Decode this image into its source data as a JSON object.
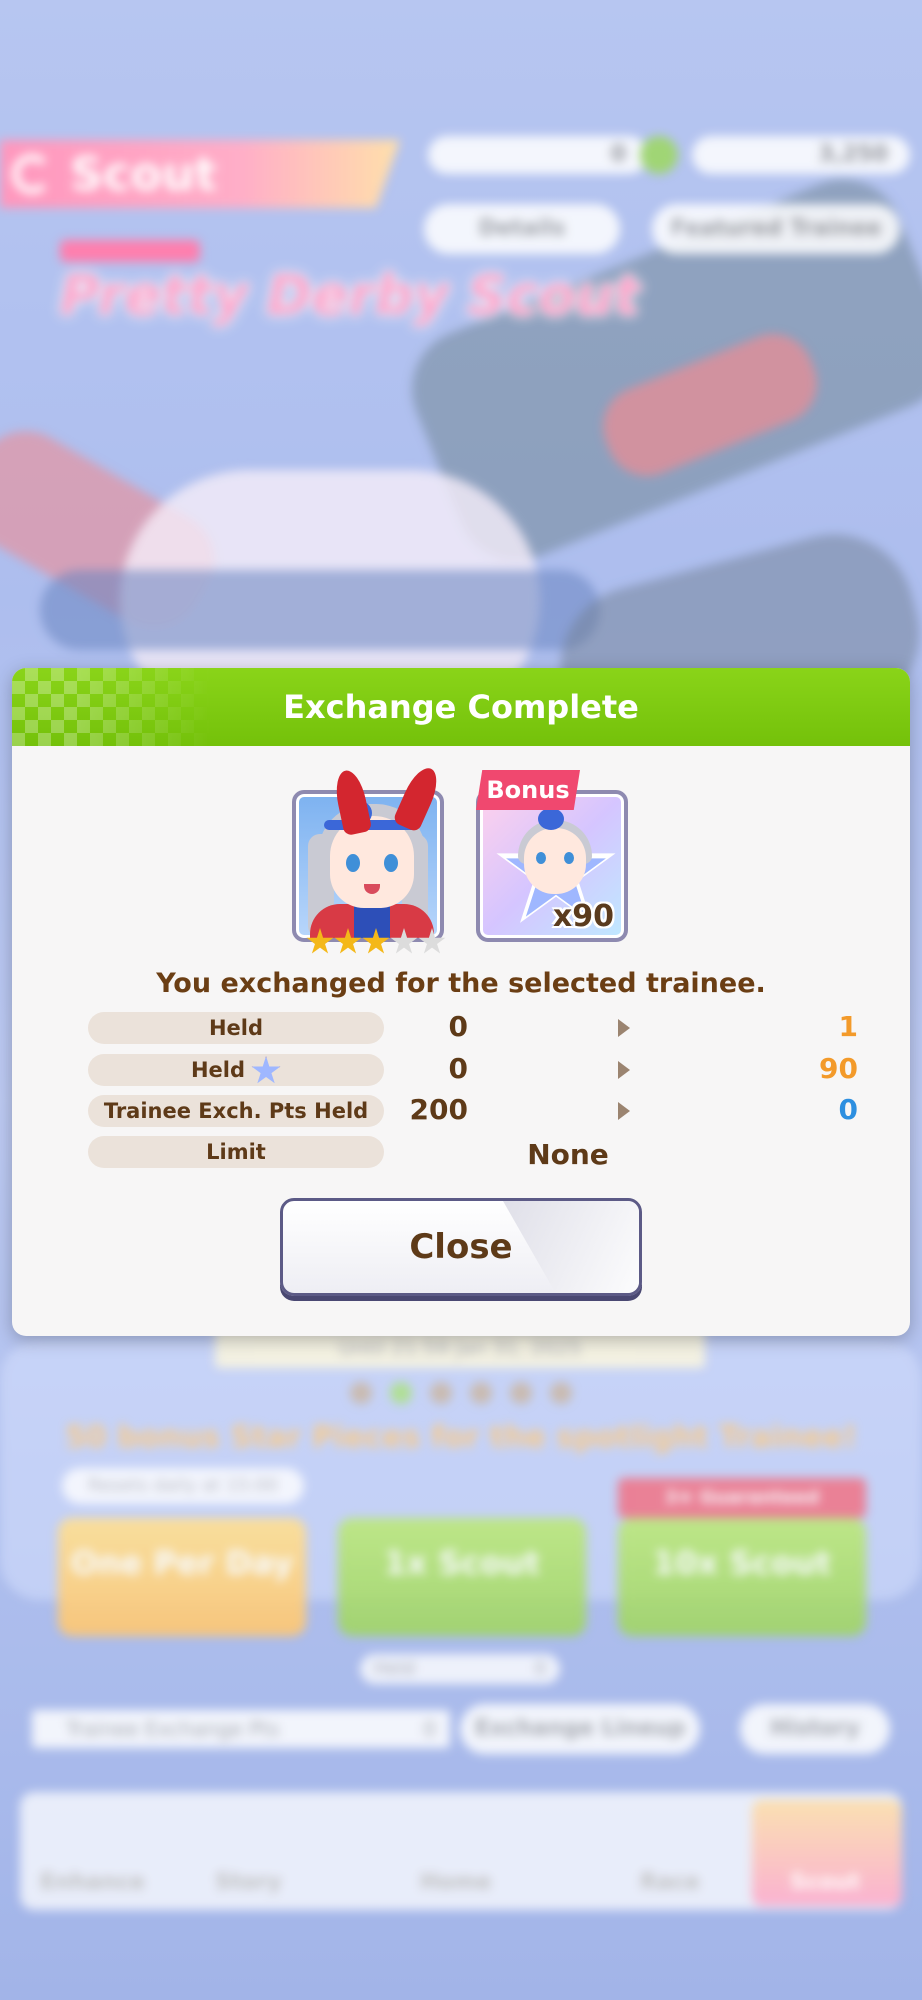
{
  "background": {
    "scout_tab": "Scout",
    "currency_left": "0",
    "currency_right": "3,250",
    "details_button": "Details",
    "featured_button": "Featured Trainee",
    "banner_logo": "Pretty Derby Scout",
    "date_text": "Until 21:59 Jan 31, 2025",
    "promo_text": "50 bonus Star Pieces for the spotlight Trainee!",
    "resets_text": "Resets daily at 15:00",
    "guarantee_tag": "3★ Guaranteed",
    "one_per_day": "One Per Day",
    "scout_1x": "1x Scout",
    "scout_10x": "10x Scout",
    "held_text": "Held",
    "held_value": "0",
    "exchange_select": "Trainee Exchange Pts",
    "exchange_select_value": "0",
    "exchange_lineup": "Exchange Lineup",
    "history_button": "History",
    "nav": [
      "Enhance",
      "Story",
      "Home",
      "Race",
      "Scout"
    ]
  },
  "dialog": {
    "title": "Exchange Complete",
    "bonus_tag": "Bonus",
    "star_piece_qty": "x90",
    "rarity": {
      "filled": 3,
      "total": 5
    },
    "message": "You exchanged for the selected trainee.",
    "rows": [
      {
        "label": "Held",
        "icon": "",
        "before": "0",
        "after": "1",
        "after_color": "#f39a2a"
      },
      {
        "label": "Held",
        "icon": "star-piece-icon",
        "before": "0",
        "after": "90",
        "after_color": "#f39a2a"
      },
      {
        "label": "Trainee Exch. Pts Held",
        "icon": "",
        "before": "200",
        "after": "0",
        "after_color": "#2d8fe0"
      }
    ],
    "limit_label": "Limit",
    "limit_value": "None",
    "close_label": "Close"
  },
  "colors": {
    "header_green": "#7bc812",
    "brown_text": "#6b3e14",
    "bonus_pink": "#f0486f",
    "gold_star": "#f4b819"
  }
}
